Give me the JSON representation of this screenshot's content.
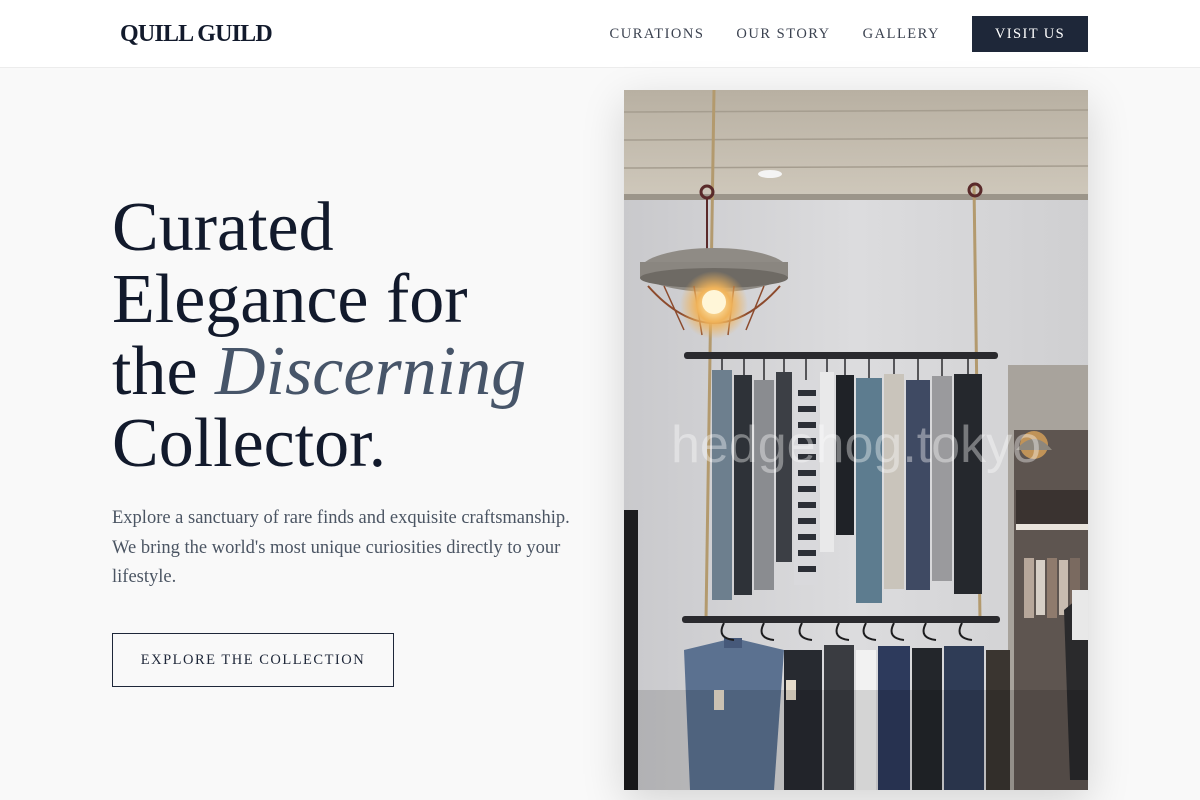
{
  "brand": {
    "logo_text": "QUILL GUILD"
  },
  "nav": {
    "links": [
      {
        "label": "CURATIONS"
      },
      {
        "label": "OUR STORY"
      },
      {
        "label": "GALLERY"
      }
    ],
    "cta_label": "VISIT US"
  },
  "hero": {
    "title": {
      "line1": "Curated",
      "line2": "Elegance for",
      "line3_prefix": "the ",
      "line3_emphasis": "Discerning",
      "line4": "Collector."
    },
    "description": "Explore a sanctuary of rare finds and exquisite craftsmanship. We bring the world's most unique curiosities directly to your lifestyle.",
    "cta_label": "EXPLORE THE COLLECTION",
    "image": {
      "watermark_text": "hedgehog.tokyo"
    }
  },
  "colors": {
    "background": "#f9f9f9",
    "header_bg": "#ffffff",
    "navy": "#1e2739",
    "heading": "#121a2c",
    "emphasis": "#475569",
    "body_text": "#4b5563"
  }
}
